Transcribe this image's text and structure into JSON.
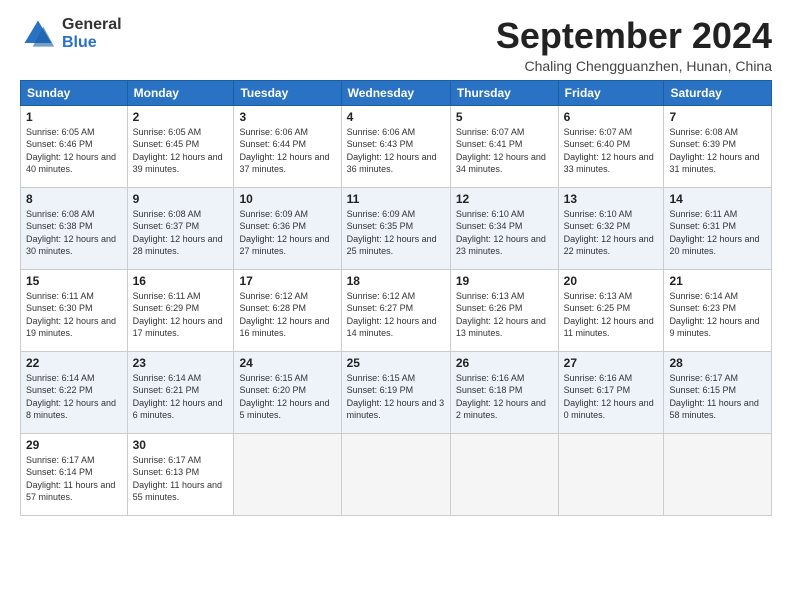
{
  "logo": {
    "general": "General",
    "blue": "Blue"
  },
  "header": {
    "month": "September 2024",
    "location": "Chaling Chengguanzhen, Hunan, China"
  },
  "days_of_week": [
    "Sunday",
    "Monday",
    "Tuesday",
    "Wednesday",
    "Thursday",
    "Friday",
    "Saturday"
  ],
  "weeks": [
    [
      {
        "day": "1",
        "sunrise": "6:05 AM",
        "sunset": "6:46 PM",
        "daylight": "12 hours and 40 minutes."
      },
      {
        "day": "2",
        "sunrise": "6:05 AM",
        "sunset": "6:45 PM",
        "daylight": "12 hours and 39 minutes."
      },
      {
        "day": "3",
        "sunrise": "6:06 AM",
        "sunset": "6:44 PM",
        "daylight": "12 hours and 37 minutes."
      },
      {
        "day": "4",
        "sunrise": "6:06 AM",
        "sunset": "6:43 PM",
        "daylight": "12 hours and 36 minutes."
      },
      {
        "day": "5",
        "sunrise": "6:07 AM",
        "sunset": "6:41 PM",
        "daylight": "12 hours and 34 minutes."
      },
      {
        "day": "6",
        "sunrise": "6:07 AM",
        "sunset": "6:40 PM",
        "daylight": "12 hours and 33 minutes."
      },
      {
        "day": "7",
        "sunrise": "6:08 AM",
        "sunset": "6:39 PM",
        "daylight": "12 hours and 31 minutes."
      }
    ],
    [
      {
        "day": "8",
        "sunrise": "6:08 AM",
        "sunset": "6:38 PM",
        "daylight": "12 hours and 30 minutes."
      },
      {
        "day": "9",
        "sunrise": "6:08 AM",
        "sunset": "6:37 PM",
        "daylight": "12 hours and 28 minutes."
      },
      {
        "day": "10",
        "sunrise": "6:09 AM",
        "sunset": "6:36 PM",
        "daylight": "12 hours and 27 minutes."
      },
      {
        "day": "11",
        "sunrise": "6:09 AM",
        "sunset": "6:35 PM",
        "daylight": "12 hours and 25 minutes."
      },
      {
        "day": "12",
        "sunrise": "6:10 AM",
        "sunset": "6:34 PM",
        "daylight": "12 hours and 23 minutes."
      },
      {
        "day": "13",
        "sunrise": "6:10 AM",
        "sunset": "6:32 PM",
        "daylight": "12 hours and 22 minutes."
      },
      {
        "day": "14",
        "sunrise": "6:11 AM",
        "sunset": "6:31 PM",
        "daylight": "12 hours and 20 minutes."
      }
    ],
    [
      {
        "day": "15",
        "sunrise": "6:11 AM",
        "sunset": "6:30 PM",
        "daylight": "12 hours and 19 minutes."
      },
      {
        "day": "16",
        "sunrise": "6:11 AM",
        "sunset": "6:29 PM",
        "daylight": "12 hours and 17 minutes."
      },
      {
        "day": "17",
        "sunrise": "6:12 AM",
        "sunset": "6:28 PM",
        "daylight": "12 hours and 16 minutes."
      },
      {
        "day": "18",
        "sunrise": "6:12 AM",
        "sunset": "6:27 PM",
        "daylight": "12 hours and 14 minutes."
      },
      {
        "day": "19",
        "sunrise": "6:13 AM",
        "sunset": "6:26 PM",
        "daylight": "12 hours and 13 minutes."
      },
      {
        "day": "20",
        "sunrise": "6:13 AM",
        "sunset": "6:25 PM",
        "daylight": "12 hours and 11 minutes."
      },
      {
        "day": "21",
        "sunrise": "6:14 AM",
        "sunset": "6:23 PM",
        "daylight": "12 hours and 9 minutes."
      }
    ],
    [
      {
        "day": "22",
        "sunrise": "6:14 AM",
        "sunset": "6:22 PM",
        "daylight": "12 hours and 8 minutes."
      },
      {
        "day": "23",
        "sunrise": "6:14 AM",
        "sunset": "6:21 PM",
        "daylight": "12 hours and 6 minutes."
      },
      {
        "day": "24",
        "sunrise": "6:15 AM",
        "sunset": "6:20 PM",
        "daylight": "12 hours and 5 minutes."
      },
      {
        "day": "25",
        "sunrise": "6:15 AM",
        "sunset": "6:19 PM",
        "daylight": "12 hours and 3 minutes."
      },
      {
        "day": "26",
        "sunrise": "6:16 AM",
        "sunset": "6:18 PM",
        "daylight": "12 hours and 2 minutes."
      },
      {
        "day": "27",
        "sunrise": "6:16 AM",
        "sunset": "6:17 PM",
        "daylight": "12 hours and 0 minutes."
      },
      {
        "day": "28",
        "sunrise": "6:17 AM",
        "sunset": "6:15 PM",
        "daylight": "11 hours and 58 minutes."
      }
    ],
    [
      {
        "day": "29",
        "sunrise": "6:17 AM",
        "sunset": "6:14 PM",
        "daylight": "11 hours and 57 minutes."
      },
      {
        "day": "30",
        "sunrise": "6:17 AM",
        "sunset": "6:13 PM",
        "daylight": "11 hours and 55 minutes."
      },
      null,
      null,
      null,
      null,
      null
    ]
  ]
}
